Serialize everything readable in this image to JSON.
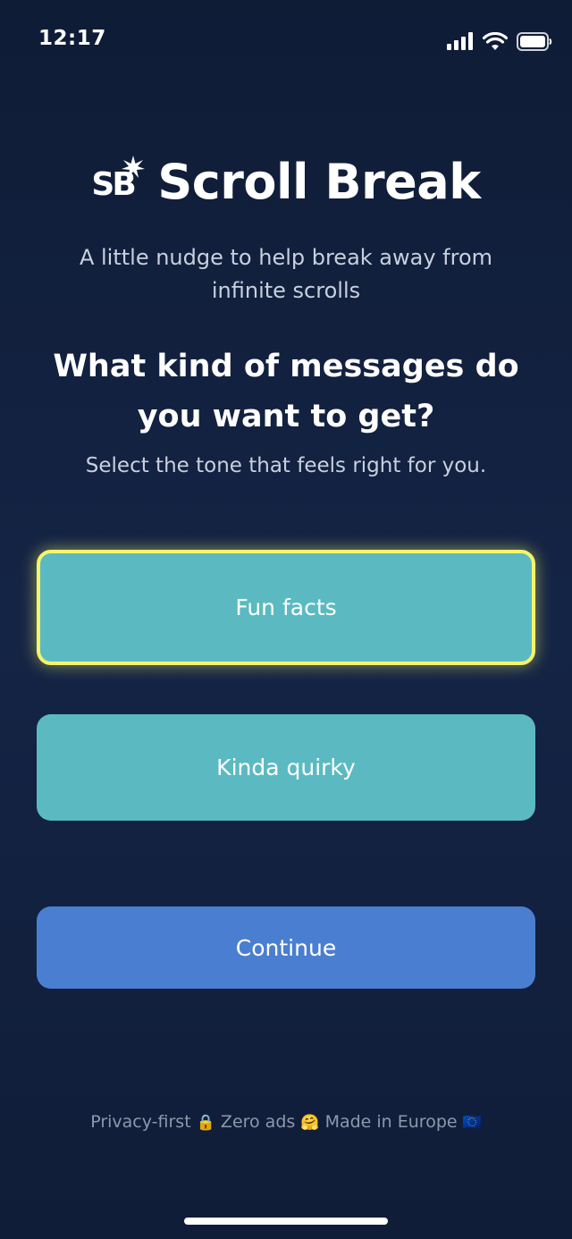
{
  "status_bar": {
    "time": "12:17",
    "icons": [
      "cellular-signal-icon",
      "wifi-icon",
      "battery-icon"
    ]
  },
  "logo": {
    "mark_text": "SB",
    "app_name": "Scroll Break"
  },
  "tagline": "A little nudge to help break away from infinite scrolls",
  "question": "What kind of messages do you want to get?",
  "subtitle": "Select the tone that feels right for you.",
  "options": [
    {
      "label": "Fun facts",
      "selected": true
    },
    {
      "label": "Kinda quirky",
      "selected": false
    }
  ],
  "continue_label": "Continue",
  "footer": {
    "privacy": "Privacy-first",
    "privacy_emoji": "🔒",
    "ads": "Zero ads",
    "ads_emoji": "🤗",
    "made_in": "Made in Europe",
    "made_in_emoji": "🇪🇺"
  },
  "colors": {
    "background": "#0f1c36",
    "option": "#5bbac1",
    "selected_border": "#f4f56a",
    "continue": "#4a7ed0"
  }
}
